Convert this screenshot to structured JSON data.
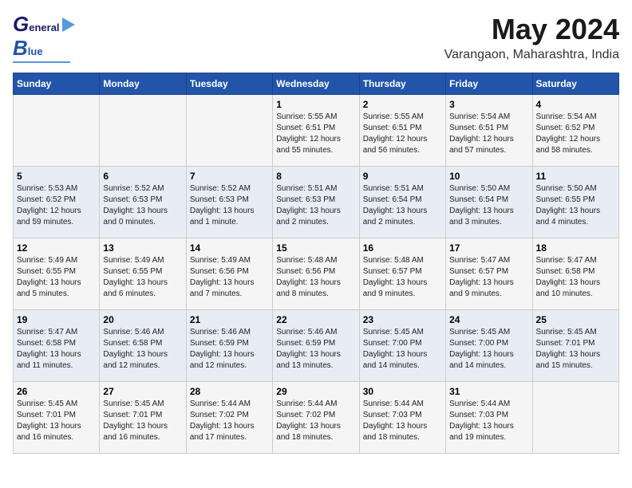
{
  "header": {
    "logo_g": "G",
    "logo_eneral": "eneral",
    "logo_b": "B",
    "logo_lue": "lue",
    "title": "May 2024",
    "subtitle": "Varangaon, Maharashtra, India"
  },
  "weekdays": [
    "Sunday",
    "Monday",
    "Tuesday",
    "Wednesday",
    "Thursday",
    "Friday",
    "Saturday"
  ],
  "rows": [
    [
      {
        "day": "",
        "info": ""
      },
      {
        "day": "",
        "info": ""
      },
      {
        "day": "",
        "info": ""
      },
      {
        "day": "1",
        "info": "Sunrise: 5:55 AM\nSunset: 6:51 PM\nDaylight: 12 hours\nand 55 minutes."
      },
      {
        "day": "2",
        "info": "Sunrise: 5:55 AM\nSunset: 6:51 PM\nDaylight: 12 hours\nand 56 minutes."
      },
      {
        "day": "3",
        "info": "Sunrise: 5:54 AM\nSunset: 6:51 PM\nDaylight: 12 hours\nand 57 minutes."
      },
      {
        "day": "4",
        "info": "Sunrise: 5:54 AM\nSunset: 6:52 PM\nDaylight: 12 hours\nand 58 minutes."
      }
    ],
    [
      {
        "day": "5",
        "info": "Sunrise: 5:53 AM\nSunset: 6:52 PM\nDaylight: 12 hours\nand 59 minutes."
      },
      {
        "day": "6",
        "info": "Sunrise: 5:52 AM\nSunset: 6:53 PM\nDaylight: 13 hours\nand 0 minutes."
      },
      {
        "day": "7",
        "info": "Sunrise: 5:52 AM\nSunset: 6:53 PM\nDaylight: 13 hours\nand 1 minute."
      },
      {
        "day": "8",
        "info": "Sunrise: 5:51 AM\nSunset: 6:53 PM\nDaylight: 13 hours\nand 2 minutes."
      },
      {
        "day": "9",
        "info": "Sunrise: 5:51 AM\nSunset: 6:54 PM\nDaylight: 13 hours\nand 2 minutes."
      },
      {
        "day": "10",
        "info": "Sunrise: 5:50 AM\nSunset: 6:54 PM\nDaylight: 13 hours\nand 3 minutes."
      },
      {
        "day": "11",
        "info": "Sunrise: 5:50 AM\nSunset: 6:55 PM\nDaylight: 13 hours\nand 4 minutes."
      }
    ],
    [
      {
        "day": "12",
        "info": "Sunrise: 5:49 AM\nSunset: 6:55 PM\nDaylight: 13 hours\nand 5 minutes."
      },
      {
        "day": "13",
        "info": "Sunrise: 5:49 AM\nSunset: 6:55 PM\nDaylight: 13 hours\nand 6 minutes."
      },
      {
        "day": "14",
        "info": "Sunrise: 5:49 AM\nSunset: 6:56 PM\nDaylight: 13 hours\nand 7 minutes."
      },
      {
        "day": "15",
        "info": "Sunrise: 5:48 AM\nSunset: 6:56 PM\nDaylight: 13 hours\nand 8 minutes."
      },
      {
        "day": "16",
        "info": "Sunrise: 5:48 AM\nSunset: 6:57 PM\nDaylight: 13 hours\nand 9 minutes."
      },
      {
        "day": "17",
        "info": "Sunrise: 5:47 AM\nSunset: 6:57 PM\nDaylight: 13 hours\nand 9 minutes."
      },
      {
        "day": "18",
        "info": "Sunrise: 5:47 AM\nSunset: 6:58 PM\nDaylight: 13 hours\nand 10 minutes."
      }
    ],
    [
      {
        "day": "19",
        "info": "Sunrise: 5:47 AM\nSunset: 6:58 PM\nDaylight: 13 hours\nand 11 minutes."
      },
      {
        "day": "20",
        "info": "Sunrise: 5:46 AM\nSunset: 6:58 PM\nDaylight: 13 hours\nand 12 minutes."
      },
      {
        "day": "21",
        "info": "Sunrise: 5:46 AM\nSunset: 6:59 PM\nDaylight: 13 hours\nand 12 minutes."
      },
      {
        "day": "22",
        "info": "Sunrise: 5:46 AM\nSunset: 6:59 PM\nDaylight: 13 hours\nand 13 minutes."
      },
      {
        "day": "23",
        "info": "Sunrise: 5:45 AM\nSunset: 7:00 PM\nDaylight: 13 hours\nand 14 minutes."
      },
      {
        "day": "24",
        "info": "Sunrise: 5:45 AM\nSunset: 7:00 PM\nDaylight: 13 hours\nand 14 minutes."
      },
      {
        "day": "25",
        "info": "Sunrise: 5:45 AM\nSunset: 7:01 PM\nDaylight: 13 hours\nand 15 minutes."
      }
    ],
    [
      {
        "day": "26",
        "info": "Sunrise: 5:45 AM\nSunset: 7:01 PM\nDaylight: 13 hours\nand 16 minutes."
      },
      {
        "day": "27",
        "info": "Sunrise: 5:45 AM\nSunset: 7:01 PM\nDaylight: 13 hours\nand 16 minutes."
      },
      {
        "day": "28",
        "info": "Sunrise: 5:44 AM\nSunset: 7:02 PM\nDaylight: 13 hours\nand 17 minutes."
      },
      {
        "day": "29",
        "info": "Sunrise: 5:44 AM\nSunset: 7:02 PM\nDaylight: 13 hours\nand 18 minutes."
      },
      {
        "day": "30",
        "info": "Sunrise: 5:44 AM\nSunset: 7:03 PM\nDaylight: 13 hours\nand 18 minutes."
      },
      {
        "day": "31",
        "info": "Sunrise: 5:44 AM\nSunset: 7:03 PM\nDaylight: 13 hours\nand 19 minutes."
      },
      {
        "day": "",
        "info": ""
      }
    ]
  ]
}
